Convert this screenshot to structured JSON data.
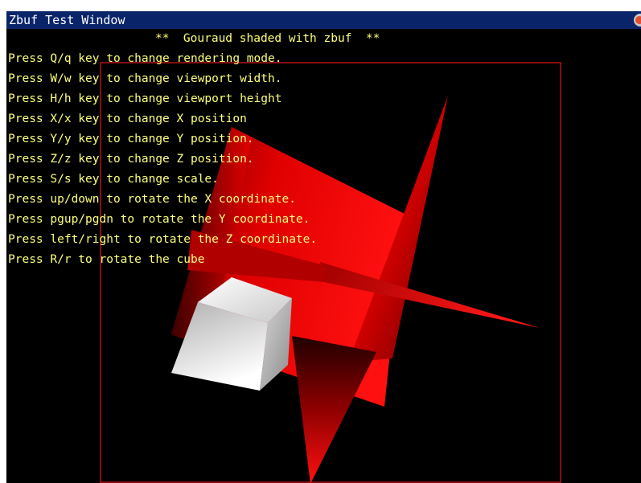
{
  "window": {
    "title": "Zbuf Test Window"
  },
  "scene": {
    "heading": "**  Gouraud shaded with zbuf  **",
    "viewport_border_color": "#ff2020",
    "plane_color": "#ff0000",
    "cube_color": "#ffffff",
    "text_color": "#ffff7a"
  },
  "instructions": [
    "Press Q/q key to change rendering mode.",
    "Press W/w key to change viewport width.",
    "Press H/h key to change viewport height",
    "Press X/x key to change X position",
    "Press Y/y key to change Y position.",
    "Press Z/z key to change Z position.",
    "Press S/s key to change scale.",
    "Press up/down to rotate the X coordinate.",
    "Press pgup/pgdn to rotate the Y coordinate.",
    "Press left/right to rotate the Z coordinate.",
    "Press R/r to rotate the cube"
  ],
  "icons": {
    "close": "close-icon"
  }
}
